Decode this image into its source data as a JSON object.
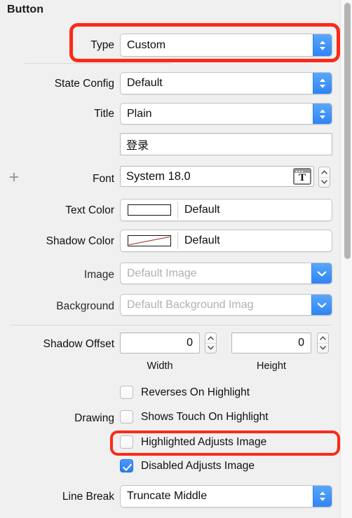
{
  "panel": {
    "title": "Button"
  },
  "rows": {
    "type": {
      "label": "Type",
      "value": "Custom"
    },
    "state_config": {
      "label": "State Config",
      "value": "Default"
    },
    "title": {
      "label": "Title",
      "value": "Plain"
    },
    "title_text": {
      "value": "登录"
    },
    "font": {
      "label": "Font",
      "value": "System 18.0",
      "glyph": "T"
    },
    "text_color": {
      "label": "Text Color",
      "value": "Default"
    },
    "shadow_color": {
      "label": "Shadow Color",
      "value": "Default"
    },
    "image": {
      "label": "Image",
      "placeholder": "Default Image"
    },
    "background": {
      "label": "Background",
      "placeholder": "Default Background Imag"
    },
    "shadow_offset": {
      "label": "Shadow Offset",
      "width_value": "0",
      "height_value": "0",
      "width_caption": "Width",
      "height_caption": "Height"
    },
    "drawing": {
      "label": "Drawing",
      "checkboxes": [
        {
          "label": "Reverses On Highlight",
          "checked": false
        },
        {
          "label": "Shows Touch On Highlight",
          "checked": false
        },
        {
          "label": "Highlighted Adjusts Image",
          "checked": false
        },
        {
          "label": "Disabled Adjusts Image",
          "checked": true
        }
      ]
    },
    "line_break": {
      "label": "Line Break",
      "value": "Truncate Middle"
    }
  },
  "icons": {
    "add": "plus-icon",
    "popup_arrow": "chevron-up-down-icon",
    "combo_arrow": "chevron-down-icon",
    "stepper_arrow": "stepper-arrows-icon",
    "font_picker": "font-panel-icon"
  },
  "colors": {
    "accent_blue": "#2f84f5",
    "annotation_red": "#fb2a18",
    "panel_bg": "#f0f0f0",
    "clear_color_slash": "#b03a3a"
  },
  "annotations": [
    {
      "name": "type-row-highlight"
    },
    {
      "name": "highlighted-adjusts-image-highlight"
    }
  ]
}
